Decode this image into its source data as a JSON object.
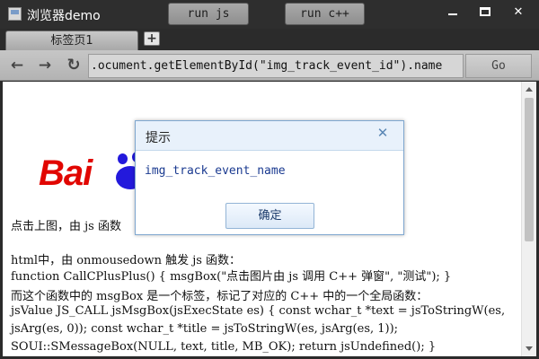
{
  "window": {
    "title": "浏览器demo",
    "run_js_label": "run js",
    "run_cpp_label": "run c++",
    "minimize_glyph": "",
    "close_glyph": "✕"
  },
  "tabs": {
    "items": [
      {
        "label": "标签页1"
      }
    ],
    "add_label": "+"
  },
  "nav": {
    "back_glyph": "←",
    "forward_glyph": "→",
    "reload_glyph": "↻",
    "address_value": ".ocument.getElementById(\"img_track_event_id\").name",
    "go_label": "Go"
  },
  "page": {
    "logo_text": "Bai",
    "line1": "点击上图，由 js 函数",
    "line2": "html中，由 onmousedown 触发 js 函数：",
    "line3": "function CallCPlusPlus() { msgBox(\"点击图片由 js 调用 C++ 弹窗\", \"测试\"); }",
    "line4": "而这个函数中的 msgBox 是一个标签，标记了对应的 C++ 中的一个全局函数：",
    "line5": "jsValue JS_CALL jsMsgBox(jsExecState es) { const wchar_t *text = jsToStringW(es,",
    "line6": "jsArg(es, 0)); const wchar_t *title = jsToStringW(es, jsArg(es, 1));",
    "line7": "SOUI::SMessageBox(NULL, text, title, MB_OK); return jsUndefined(); }"
  },
  "dialog": {
    "title": "提示",
    "close_glyph": "✕",
    "message": "img_track_event_name",
    "ok_label": "确定"
  },
  "colors": {
    "logo_red": "#e10601",
    "logo_blue": "#2319dc",
    "dialog_border": "#7fa7cf",
    "dialog_text": "#1a3a90"
  }
}
